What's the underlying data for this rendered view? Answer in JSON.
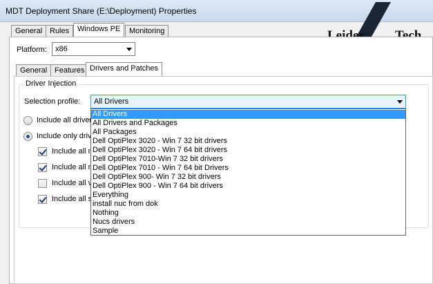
{
  "window": {
    "title": "MDT Deployment Share (E:\\Deployment) Properties"
  },
  "logo": {
    "left_word": "Leider",
    "right_word": "Tech"
  },
  "main_tabs": [
    {
      "label": "General"
    },
    {
      "label": "Rules"
    },
    {
      "label": "Windows PE"
    },
    {
      "label": "Monitoring"
    }
  ],
  "platform": {
    "label": "Platform:",
    "value": "x86"
  },
  "sub_tabs": [
    {
      "label": "General"
    },
    {
      "label": "Features"
    },
    {
      "label": "Drivers and Patches"
    }
  ],
  "driver_injection": {
    "title": "Driver Injection",
    "profile_label": "Selection profile:",
    "profile_value": "All Drivers",
    "options": [
      {
        "label": "Include all driver"
      },
      {
        "label": "Include only driv"
      }
    ],
    "checks": [
      {
        "label": "Include all n",
        "checked": true
      },
      {
        "label": "Include all m",
        "checked": true
      },
      {
        "label": "Include all v",
        "checked": false
      },
      {
        "label": "Include all s",
        "checked": true
      }
    ]
  },
  "dropdown_items": [
    "All Drivers",
    "All Drivers and Packages",
    "All Packages",
    "Dell OptiPlex 3020 - Win 7 32 bit drivers",
    "Dell OptiPlex 3020 - Win 7 64 bit drivers",
    "Dell OptiPlex 7010-Win 7 32 bit drivers",
    "Dell OptiPlex 7010 - Win 7 64 bit Drivers",
    "Dell OptiPlex 900- Win 7 32 bit drivers",
    "Dell OptiPlex 900 - Win 7 64 bit drivers",
    "Everything",
    "install nuc from dok",
    "Nothing",
    "Nucs drivers",
    "Sample"
  ],
  "colors": {
    "selection": "#3399ff",
    "title_bar": "#dde9f5"
  }
}
